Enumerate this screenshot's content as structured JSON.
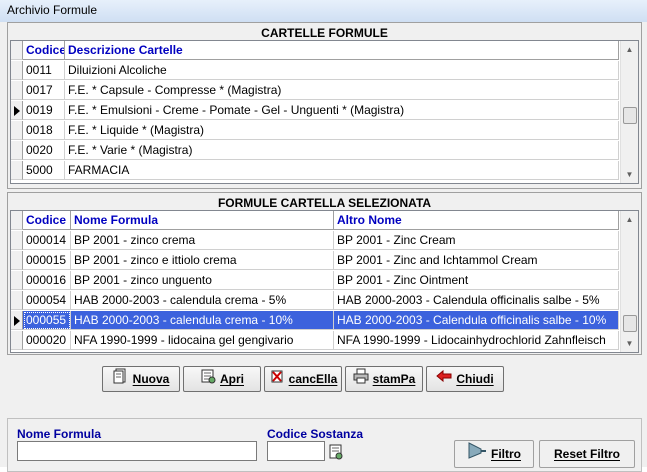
{
  "window": {
    "title": "Archivio Formule"
  },
  "cartelle": {
    "title": "CARTELLE FORMULE",
    "columns": [
      "Codice",
      "Descrizione Cartelle"
    ],
    "rows": [
      [
        "0011",
        "Diluizioni Alcoliche"
      ],
      [
        "0017",
        "F.E. * Capsule - Compresse * (Magistra)"
      ],
      [
        "0019",
        "F.E. * Emulsioni - Creme - Pomate - Gel - Unguenti * (Magistra)"
      ],
      [
        "0018",
        "F.E. * Liquide * (Magistra)"
      ],
      [
        "0020",
        "F.E. * Varie * (Magistra)"
      ],
      [
        "5000",
        "FARMACIA"
      ]
    ],
    "current_index": 2
  },
  "formule": {
    "title": "FORMULE  CARTELLA SELEZIONATA",
    "columns": [
      "Codice",
      "Nome Formula",
      "Altro Nome"
    ],
    "rows": [
      [
        "000014",
        "BP 2001 - zinco crema",
        "BP 2001 - Zinc Cream"
      ],
      [
        "000015",
        "BP 2001 - zinco e ittiolo crema",
        "BP 2001 - Zinc and Ichtammol Cream"
      ],
      [
        "000016",
        "BP 2001 - zinco unguento",
        "BP 2001 - Zinc Ointment"
      ],
      [
        "000054",
        "HAB 2000-2003 - calendula crema -  5%",
        "HAB 2000-2003 - Calendula officinalis salbe -  5%"
      ],
      [
        "000055",
        "HAB 2000-2003 - calendula crema - 10%",
        "HAB 2000-2003 - Calendula officinalis salbe - 10%"
      ],
      [
        "000020",
        "NFA 1990-1999 - lidocaina gel gengivario",
        "NFA 1990-1999 - Lidocainhydrochlorid Zahnfleisch"
      ]
    ],
    "selected_index": 4
  },
  "buttons": {
    "nuova": "Nuova",
    "apri": "Apri",
    "cancella": "cancElla",
    "stampa": "stamPa",
    "chiudi": "Chiudi"
  },
  "filter": {
    "nome_formula_label": "Nome Formula",
    "nome_formula_value": "",
    "codice_sostanza_label": "Codice Sostanza",
    "codice_sostanza_value": "",
    "filtro_button": "Filtro",
    "reset_button": "Reset Filtro"
  }
}
